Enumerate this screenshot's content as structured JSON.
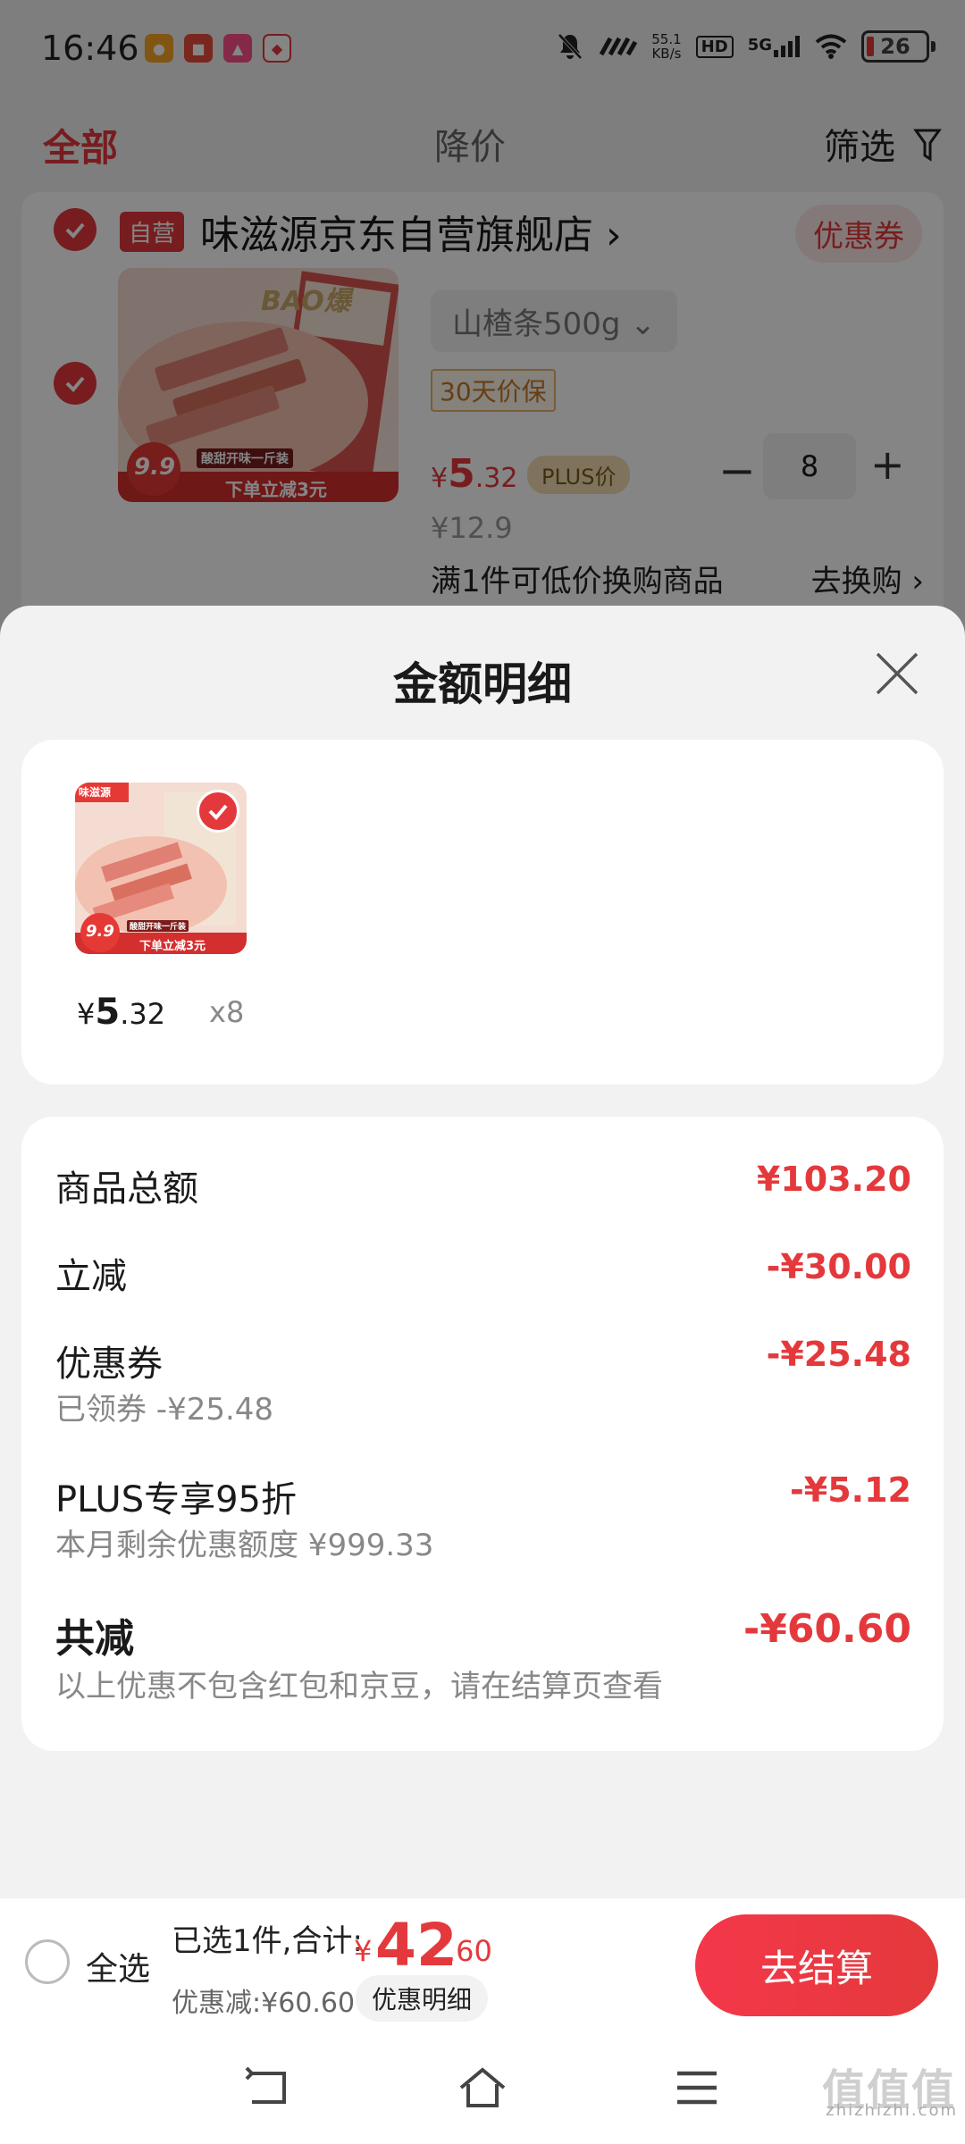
{
  "status_bar": {
    "time": "16:46",
    "network_speed": "55.1",
    "network_unit": "KB/s",
    "hd": "HD",
    "signal": "5G",
    "battery": "26"
  },
  "tabs": {
    "all": "全部",
    "price_drop": "降价",
    "filter": "筛选"
  },
  "shop": {
    "self_operated": "自营",
    "name": "味滋源京东自营旗舰店 ›",
    "coupon": "优惠券",
    "spec": "山楂条500g ⌄",
    "guarantee": "30天价保",
    "price_currency": "¥",
    "price_int": "5",
    "price_dec": ".32",
    "plus_label": "PLUS价",
    "quantity": "8",
    "original_price": "¥12.9",
    "tradein_text": "满1件可低价换购商品",
    "tradein_link": "去换购 ›",
    "image_text": {
      "brand": "BAO爆",
      "promo_price": "9.9",
      "promo_strip": "下单立减3元",
      "tagline": "酸甜开味一斤装"
    }
  },
  "sheet": {
    "title": "金额明细",
    "item": {
      "price_currency": "¥",
      "price_int": "5",
      "price_dec": ".32",
      "qty": "x8",
      "image_text": {
        "brand": "味滋源",
        "promo_price": "9.9",
        "promo_strip": "下单立减3元",
        "tagline": "酸甜开味一斤装"
      }
    },
    "rows": [
      {
        "label": "商品总额",
        "value": "¥103.20",
        "sub": ""
      },
      {
        "label": "立减",
        "value": "-¥30.00",
        "sub": ""
      },
      {
        "label": "优惠券",
        "value": "-¥25.48",
        "sub": "已领券 -¥25.48"
      },
      {
        "label": "PLUS专享95折",
        "value": "-¥5.12",
        "sub": "本月剩余优惠额度 ¥999.33"
      },
      {
        "label": "共减",
        "value": "-¥60.60",
        "sub": "以上优惠不包含红包和京豆，请在结算页查看"
      }
    ]
  },
  "checkout": {
    "select_all": "全选",
    "summary": "已选1件,合计:",
    "total_currency": "¥",
    "total_int": "42",
    "total_dec": ".60",
    "discount": "优惠减:¥60.60",
    "detail_link": "优惠明细",
    "checkout_button": "去结算"
  },
  "watermark": {
    "logo": "值值值",
    "url": "zhizhizhi.com"
  },
  "colors": {
    "accent": "#e4393c",
    "background": "#f2f2f2"
  }
}
